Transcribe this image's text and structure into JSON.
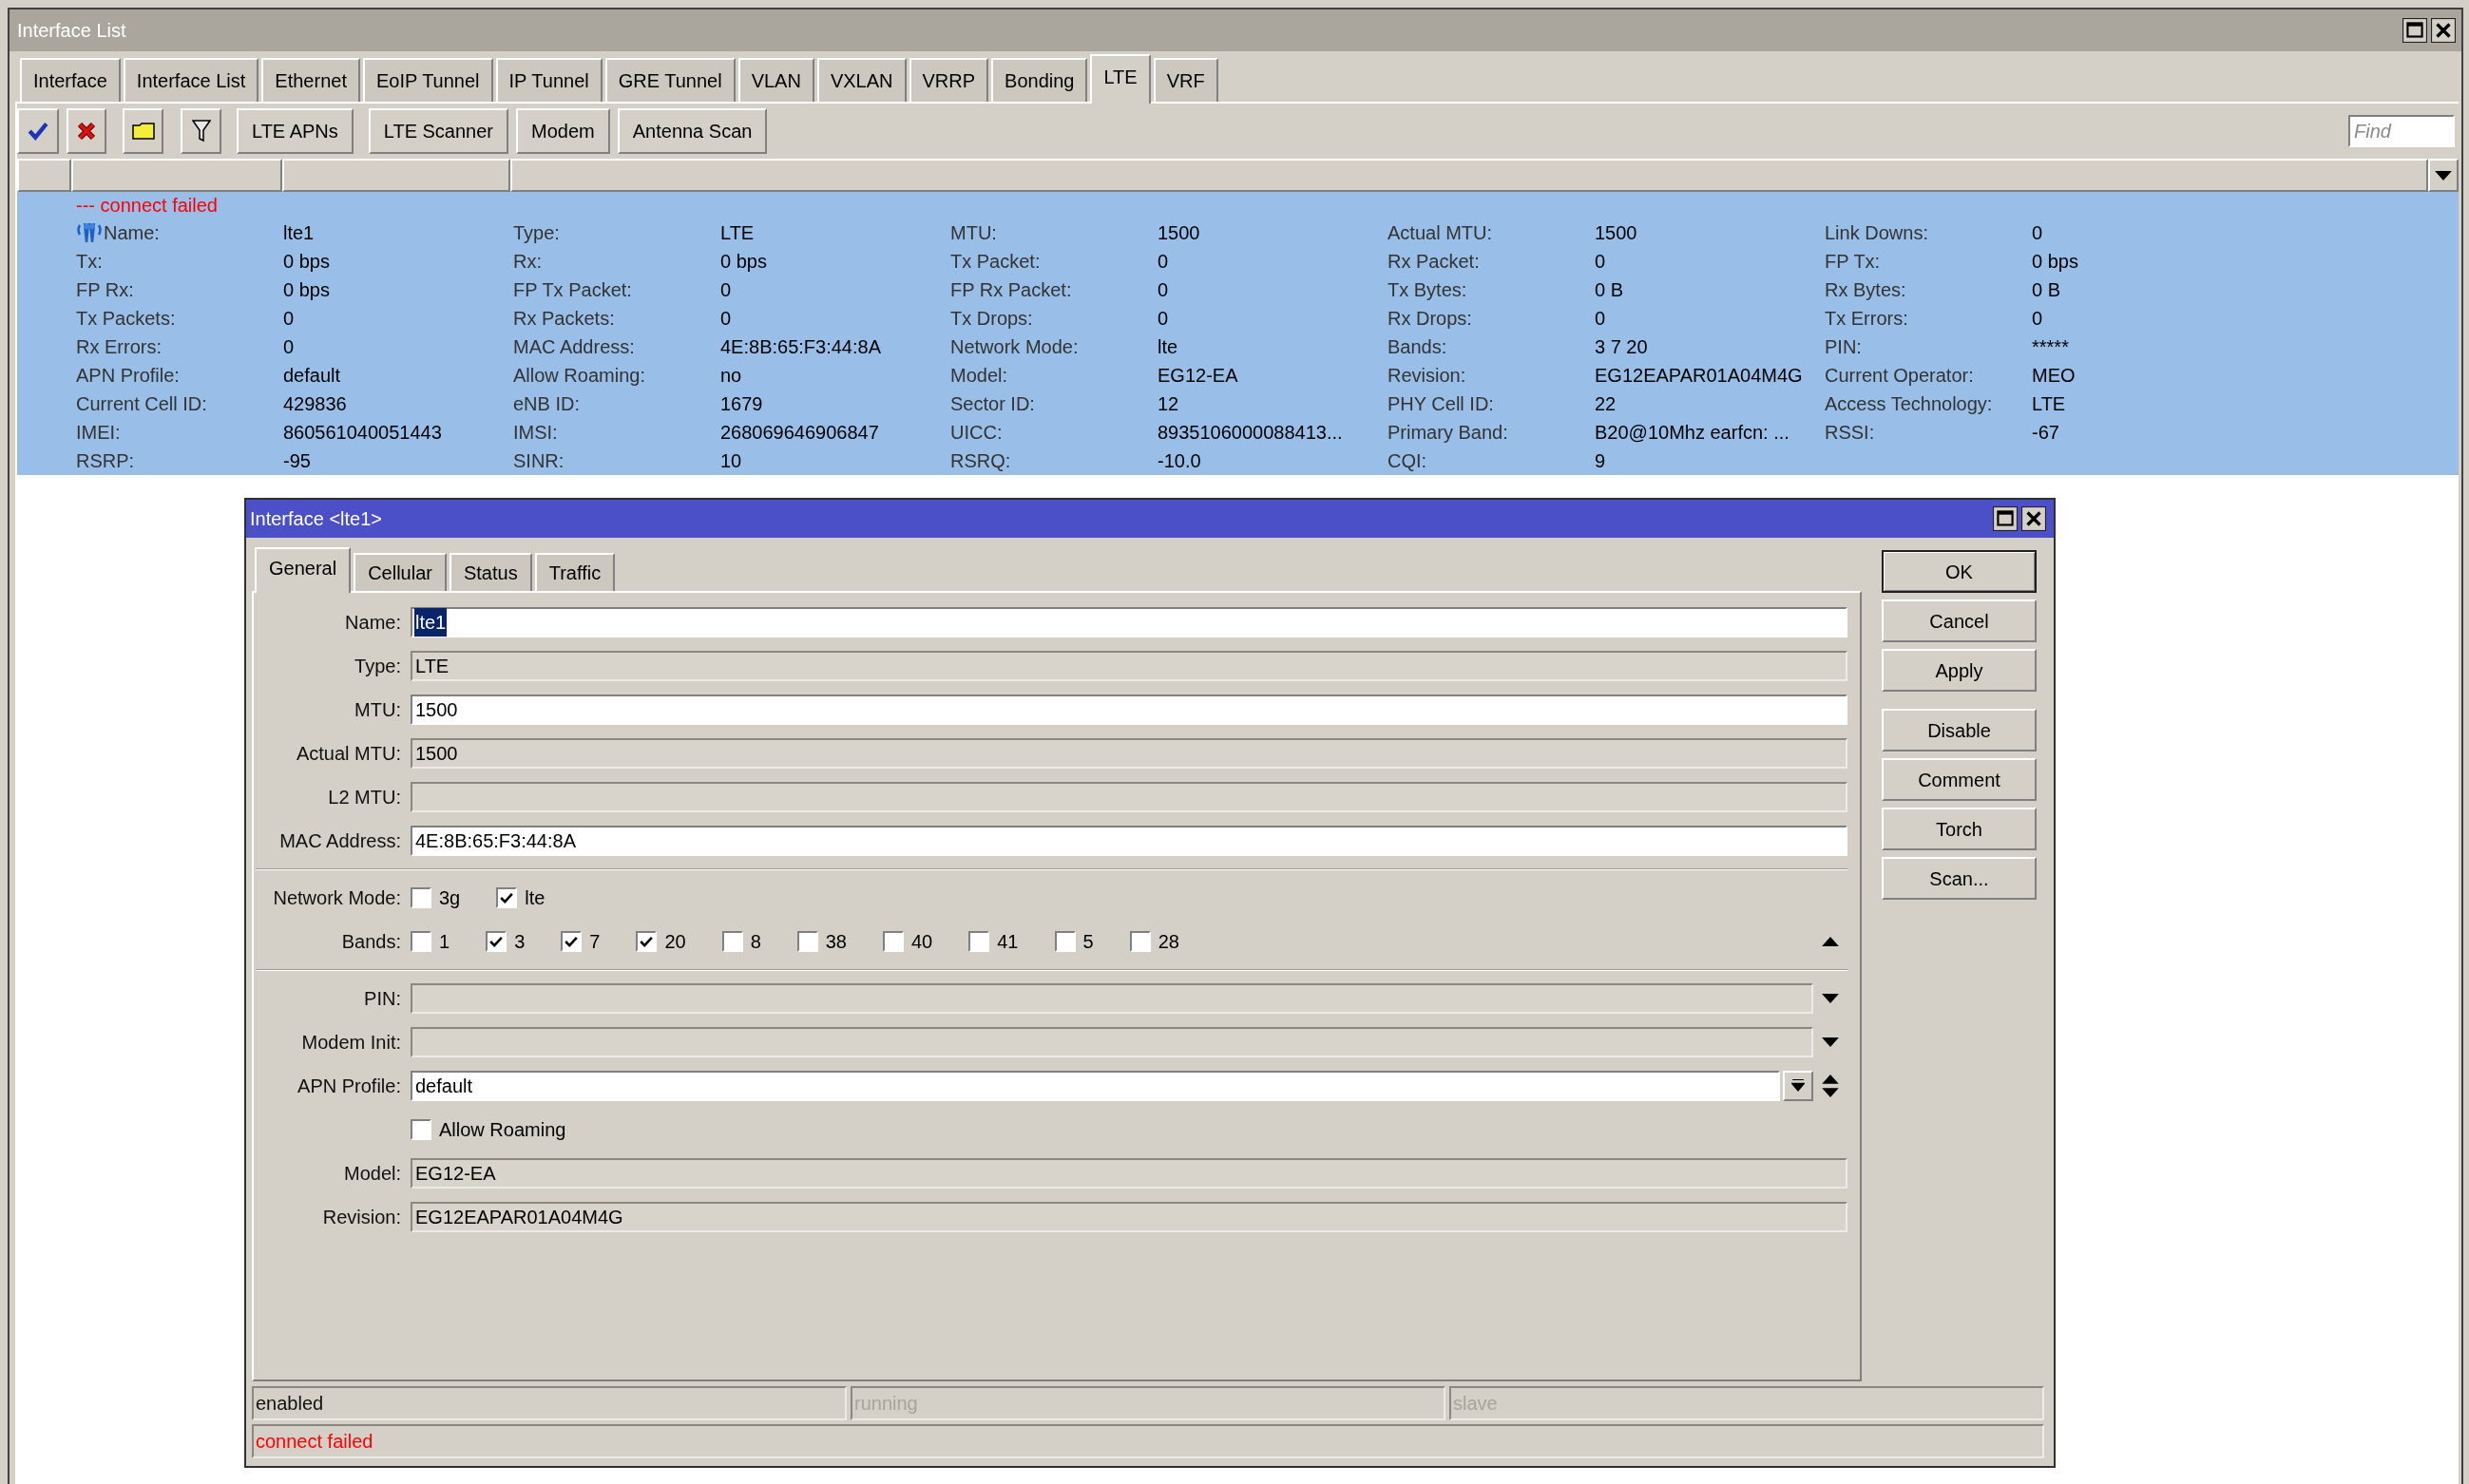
{
  "window": {
    "title": "Interface List"
  },
  "tabs": [
    {
      "label": "Interface",
      "selected": false
    },
    {
      "label": "Interface List",
      "selected": false
    },
    {
      "label": "Ethernet",
      "selected": false
    },
    {
      "label": "EoIP Tunnel",
      "selected": false
    },
    {
      "label": "IP Tunnel",
      "selected": false
    },
    {
      "label": "GRE Tunnel",
      "selected": false
    },
    {
      "label": "VLAN",
      "selected": false
    },
    {
      "label": "VXLAN",
      "selected": false
    },
    {
      "label": "VRRP",
      "selected": false
    },
    {
      "label": "Bonding",
      "selected": false
    },
    {
      "label": "LTE",
      "selected": true
    },
    {
      "label": "VRF",
      "selected": false
    }
  ],
  "toolbar": {
    "buttons": [
      "LTE APNs",
      "LTE Scanner",
      "Modem",
      "Antenna Scan"
    ]
  },
  "search": {
    "placeholder": "Find"
  },
  "table": {
    "rows": [
      {
        "selected": true,
        "comment": "--- connect failed",
        "fields": [
          {
            "label": "Name:",
            "value": "lte1"
          },
          {
            "label": "Type:",
            "value": "LTE"
          },
          {
            "label": "MTU:",
            "value": "1500"
          },
          {
            "label": "Actual MTU:",
            "value": "1500"
          },
          {
            "label": "Link Downs:",
            "value": "0"
          },
          {
            "label": "Tx:",
            "value": "0 bps"
          },
          {
            "label": "Rx:",
            "value": "0 bps"
          },
          {
            "label": "Tx Packet:",
            "value": "0"
          },
          {
            "label": "Rx Packet:",
            "value": "0"
          },
          {
            "label": "FP Tx:",
            "value": "0 bps"
          },
          {
            "label": "FP Rx:",
            "value": "0 bps"
          },
          {
            "label": "FP Tx Packet:",
            "value": "0"
          },
          {
            "label": "FP Rx Packet:",
            "value": "0"
          },
          {
            "label": "Tx Bytes:",
            "value": "0 B"
          },
          {
            "label": "Rx Bytes:",
            "value": "0 B"
          },
          {
            "label": "Tx Packets:",
            "value": "0"
          },
          {
            "label": "Rx Packets:",
            "value": "0"
          },
          {
            "label": "Tx Drops:",
            "value": "0"
          },
          {
            "label": "Rx Drops:",
            "value": "0"
          },
          {
            "label": "Tx Errors:",
            "value": "0"
          },
          {
            "label": "Rx Errors:",
            "value": "0"
          },
          {
            "label": "MAC Address:",
            "value": "4E:8B:65:F3:44:8A"
          },
          {
            "label": "Network Mode:",
            "value": "lte"
          },
          {
            "label": "Bands:",
            "value": "3 7 20"
          },
          {
            "label": "PIN:",
            "value": "*****"
          },
          {
            "label": "APN Profile:",
            "value": "default"
          },
          {
            "label": "Allow Roaming:",
            "value": "no"
          },
          {
            "label": "Model:",
            "value": "EG12-EA"
          },
          {
            "label": "Revision:",
            "value": "EG12EAPAR01A04M4G"
          },
          {
            "label": "Current Operator:",
            "value": "MEO"
          },
          {
            "label": "Current Cell ID:",
            "value": "429836"
          },
          {
            "label": "eNB ID:",
            "value": "1679"
          },
          {
            "label": "Sector ID:",
            "value": "12"
          },
          {
            "label": "PHY Cell ID:",
            "value": "22"
          },
          {
            "label": "Access Technology:",
            "value": "LTE"
          },
          {
            "label": "IMEI:",
            "value": "860561040051443"
          },
          {
            "label": "IMSI:",
            "value": "268069646906847"
          },
          {
            "label": "UICC:",
            "value": "8935106000088413..."
          },
          {
            "label": "Primary Band:",
            "value": "B20@10Mhz earfcn: ..."
          },
          {
            "label": "RSSI:",
            "value": "-67"
          },
          {
            "label": "RSRP:",
            "value": "-95"
          },
          {
            "label": "SINR:",
            "value": "10"
          },
          {
            "label": "RSRQ:",
            "value": "-10.0"
          },
          {
            "label": "CQI:",
            "value": "9"
          }
        ]
      }
    ]
  },
  "dialog": {
    "title": "Interface <lte1>",
    "tabs": [
      {
        "label": "General",
        "selected": true
      },
      {
        "label": "Cellular",
        "selected": false
      },
      {
        "label": "Status",
        "selected": false
      },
      {
        "label": "Traffic",
        "selected": false
      }
    ],
    "sections": [
      [
        {
          "kind": "input",
          "label": "Name:",
          "value": "lte1",
          "text_selected": true
        },
        {
          "kind": "readonly",
          "label": "Type:",
          "value": "LTE"
        },
        {
          "kind": "input",
          "label": "MTU:",
          "value": "1500",
          "text_selected": false
        },
        {
          "kind": "readonly",
          "label": "Actual MTU:",
          "value": "1500"
        },
        {
          "kind": "readonly",
          "label": "L2 MTU:"
        },
        {
          "kind": "input",
          "label": "MAC Address:",
          "value": "4E:8B:65:F3:44:8A",
          "text_selected": false
        }
      ],
      [
        {
          "kind": "checks",
          "label": "Network Mode:",
          "options": [
            {
              "label": "3g",
              "checked": false
            },
            {
              "label": "lte",
              "checked": true
            }
          ]
        },
        {
          "kind": "checklist",
          "label": "Bands:",
          "options": [
            {
              "label": "1",
              "checked": false
            },
            {
              "label": "3",
              "checked": true
            },
            {
              "label": "7",
              "checked": true
            },
            {
              "label": "20",
              "checked": true
            },
            {
              "label": "8",
              "checked": false
            },
            {
              "label": "38",
              "checked": false
            },
            {
              "label": "40",
              "checked": false
            },
            {
              "label": "41",
              "checked": false
            },
            {
              "label": "5",
              "checked": false
            },
            {
              "label": "28",
              "checked": false
            }
          ]
        }
      ],
      [
        {
          "kind": "optional",
          "label": "PIN:"
        },
        {
          "kind": "optional",
          "label": "Modem Init:"
        },
        {
          "kind": "combo",
          "label": "APN Profile:",
          "value": "default"
        },
        {
          "kind": "checkbox",
          "label": "Allow Roaming",
          "checked": false
        },
        {
          "kind": "readonly",
          "label": "Model:",
          "value": "EG12-EA"
        },
        {
          "kind": "readonly",
          "label": "Revision:",
          "value": "EG12EAPAR01A04M4G"
        }
      ]
    ],
    "button_groups": [
      [
        {
          "label": "OK",
          "default": true
        },
        {
          "label": "Cancel",
          "default": false
        },
        {
          "label": "Apply",
          "default": false
        }
      ],
      [
        {
          "label": "Disable",
          "default": false
        },
        {
          "label": "Comment",
          "default": false
        },
        {
          "label": "Torch",
          "default": false
        },
        {
          "label": "Scan...",
          "default": false
        }
      ]
    ],
    "status": [
      {
        "label": "enabled",
        "active": true
      },
      {
        "label": "running",
        "active": false
      },
      {
        "label": "slave",
        "active": false
      }
    ],
    "message": "connect failed"
  }
}
